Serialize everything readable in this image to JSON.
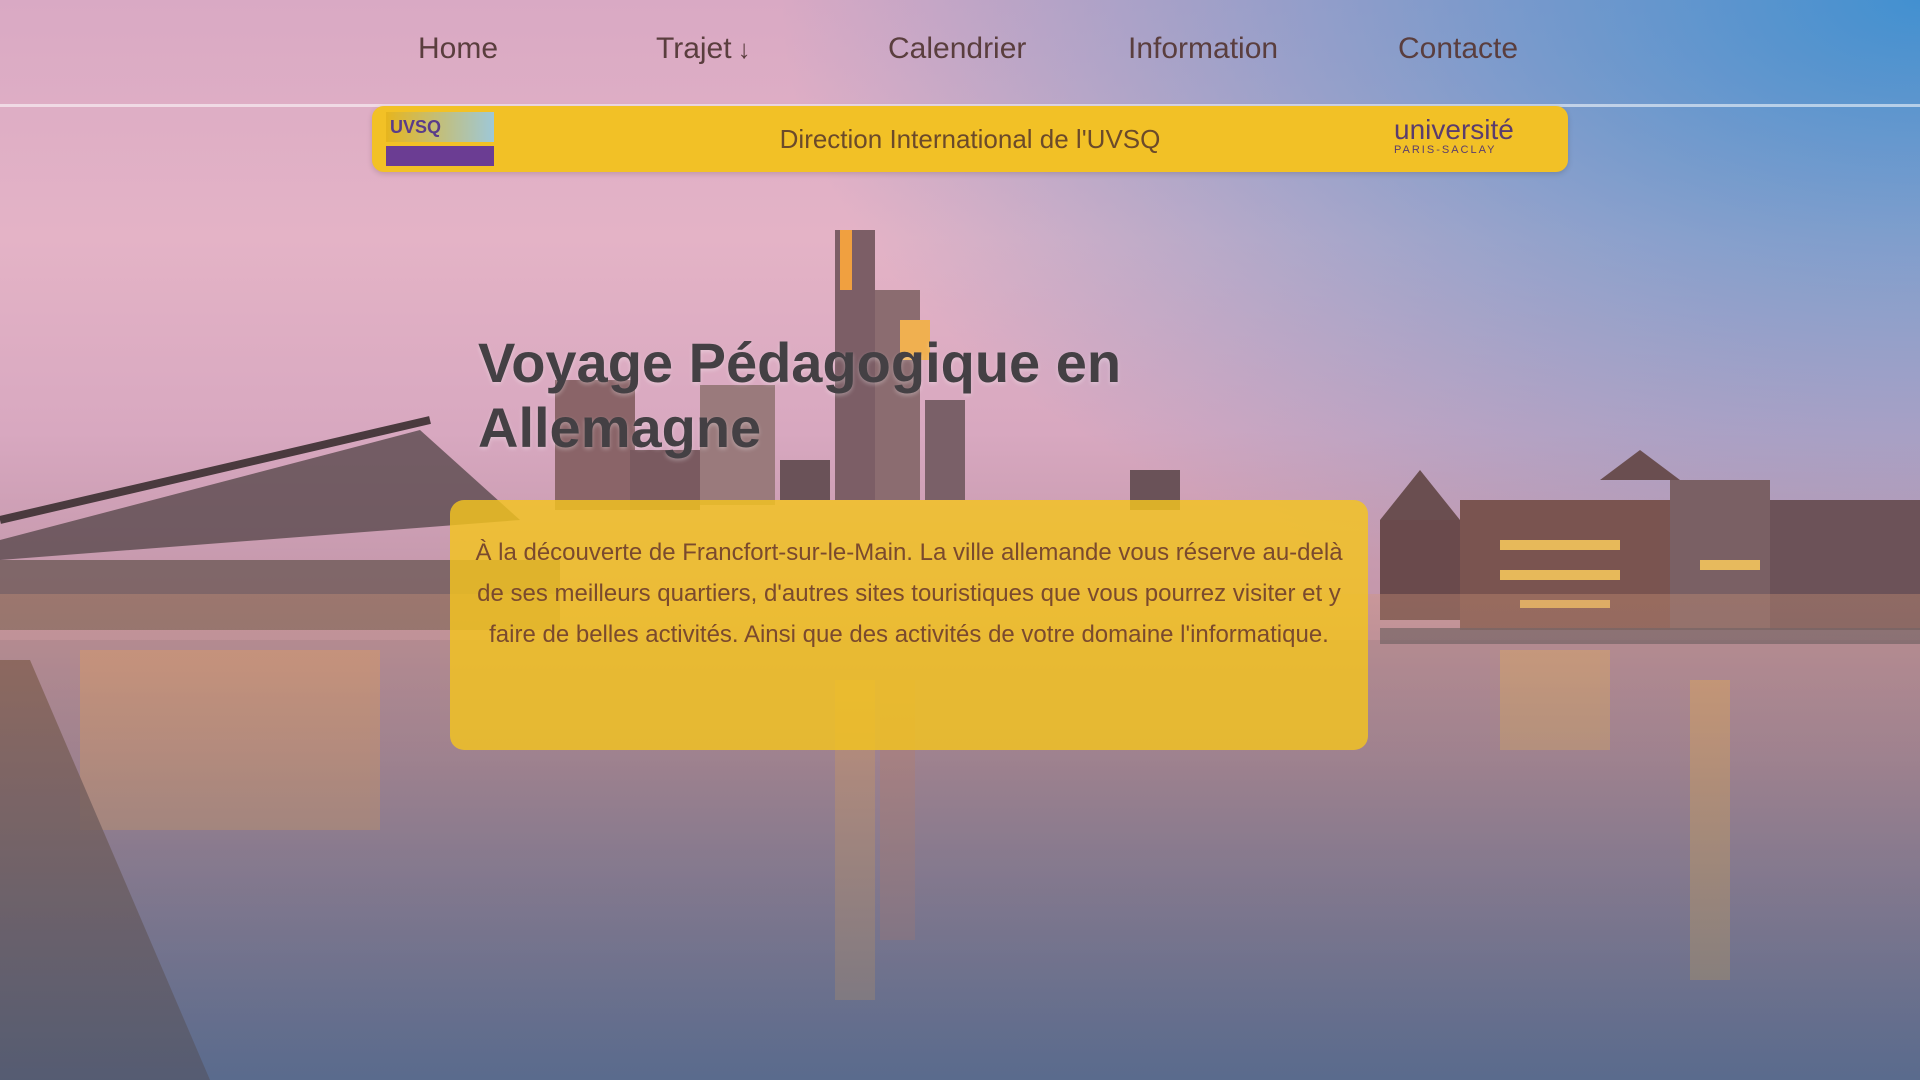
{
  "nav": {
    "items": [
      {
        "label": "Home"
      },
      {
        "label": "Trajet",
        "has_dropdown": true,
        "arrow": "↓"
      },
      {
        "label": "Calendrier"
      },
      {
        "label": "Information"
      },
      {
        "label": "Contacte"
      }
    ]
  },
  "banner": {
    "title": "Direction International de l'UVSQ",
    "left_logo_text": "UVSQ",
    "right_logo_text": "université",
    "right_logo_subtext": "PARIS-SACLAY"
  },
  "hero": {
    "title": "Voyage Pédagogique en Allemagne",
    "description": "À la découverte de Francfort-sur-le-Main. La ville allemande vous réserve au-delà de ses meilleurs quartiers, d'autres sites touristiques que vous pourrez visiter et y faire de belles activités. Ainsi que des activités de votre domaine l'informatique."
  },
  "colors": {
    "banner_yellow": "#f2c126",
    "nav_text": "#5a3e3e",
    "description_text": "#7a4a2e"
  }
}
